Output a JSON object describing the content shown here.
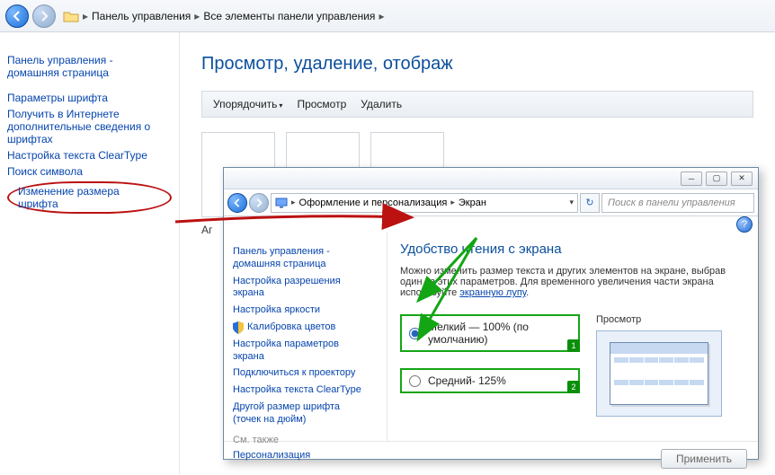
{
  "outer": {
    "breadcrumb_parts": [
      "Панель управления",
      "Все элементы панели управления"
    ],
    "left_links": {
      "home_l1": "Панель управления -",
      "home_l2": "домашняя страница",
      "l1": "Параметры шрифта",
      "l2": "Получить в Интернете",
      "l2b": "дополнительные сведения о",
      "l2c": "шрифтах",
      "l3": "Настройка текста ClearType",
      "l4": "Поиск символа",
      "l5": "Изменение размера шрифта"
    },
    "title": "Просмотр, удаление, отображ",
    "cmd_arrange": "Упорядочить",
    "cmd_view": "Просмотр",
    "cmd_delete": "Удалить",
    "truncated_row_label": "Аг"
  },
  "sub": {
    "breadcrumb": {
      "a": "Оформление и персонализация",
      "b": "Экран"
    },
    "search_placeholder": "Поиск в панели управления",
    "left": {
      "home_l1": "Панель управления -",
      "home_l2": "домашняя страница",
      "l1a": "Настройка разрешения",
      "l1b": "экрана",
      "l2": "Настройка яркости",
      "l3": "Калибровка цветов",
      "l4a": "Настройка параметров",
      "l4b": "экрана",
      "l5": "Подключиться к проектору",
      "l6": "Настройка текста ClearType",
      "l7a": "Другой размер шрифта",
      "l7b": "(точек на дюйм)",
      "see_also": "См. также",
      "persona": "Персонализация"
    },
    "main": {
      "heading": "Удобство чтения с экрана",
      "desc_1": "Можно изменить размер текста и других элементов на экране, выбрав один из этих параметров. Для временного увеличения части экрана используйте ",
      "desc_link": "экранную лупу",
      "desc_2": ".",
      "opt1": "Мелкий — 100% (по умолчанию)",
      "opt2": "Средний- 125%",
      "preview_label": "Просмотр",
      "apply": "Применить"
    }
  }
}
